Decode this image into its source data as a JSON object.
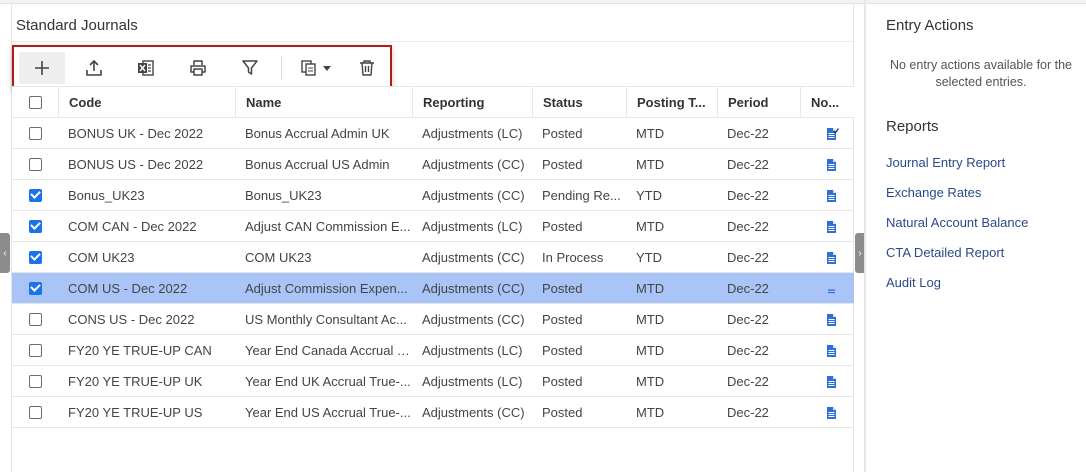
{
  "main": {
    "title": "Standard Journals",
    "toolbar": {
      "add_icon": "plus-icon",
      "upload_icon": "upload-icon",
      "excel_icon": "excel-export-icon",
      "print_icon": "print-icon",
      "filter_icon": "filter-icon",
      "copy_icon": "copy-dropdown-icon",
      "delete_icon": "trash-icon"
    },
    "columns": [
      "Code",
      "Name",
      "Reporting",
      "Status",
      "Posting T...",
      "Period",
      "No..."
    ],
    "rows": [
      {
        "checked": false,
        "selected": false,
        "code": "BONUS UK - Dec 2022",
        "name": "Bonus Accrual Admin UK",
        "reporting": "Adjustments (LC)",
        "status": "Posted",
        "posting": "MTD",
        "period": "Dec-22",
        "note_icon": "document-check-icon"
      },
      {
        "checked": false,
        "selected": false,
        "code": "BONUS US - Dec 2022",
        "name": "Bonus Accrual US Admin",
        "reporting": "Adjustments (CC)",
        "status": "Posted",
        "posting": "MTD",
        "period": "Dec-22",
        "note_icon": "document-icon"
      },
      {
        "checked": true,
        "selected": false,
        "code": "Bonus_UK23",
        "name": "Bonus_UK23",
        "reporting": "Adjustments (CC)",
        "status": "Pending Re...",
        "posting": "YTD",
        "period": "Dec-22",
        "note_icon": "document-icon"
      },
      {
        "checked": true,
        "selected": false,
        "code": "COM CAN - Dec 2022",
        "name": "Adjust CAN Commission E...",
        "reporting": "Adjustments (LC)",
        "status": "Posted",
        "posting": "MTD",
        "period": "Dec-22",
        "note_icon": "document-icon"
      },
      {
        "checked": true,
        "selected": false,
        "code": "COM UK23",
        "name": "COM UK23",
        "reporting": "Adjustments (CC)",
        "status": "In Process",
        "posting": "YTD",
        "period": "Dec-22",
        "note_icon": "document-icon"
      },
      {
        "checked": true,
        "selected": true,
        "code": "COM US - Dec 2022",
        "name": "Adjust Commission Expen...",
        "reporting": "Adjustments (CC)",
        "status": "Posted",
        "posting": "MTD",
        "period": "Dec-22",
        "note_icon": "lines-icon"
      },
      {
        "checked": false,
        "selected": false,
        "code": "CONS US - Dec 2022",
        "name": "US Monthly Consultant Ac...",
        "reporting": "Adjustments (CC)",
        "status": "Posted",
        "posting": "MTD",
        "period": "Dec-22",
        "note_icon": "document-icon"
      },
      {
        "checked": false,
        "selected": false,
        "code": "FY20 YE TRUE-UP CAN",
        "name": "Year End Canada Accrual T...",
        "reporting": "Adjustments (LC)",
        "status": "Posted",
        "posting": "MTD",
        "period": "Dec-22",
        "note_icon": "document-icon"
      },
      {
        "checked": false,
        "selected": false,
        "code": "FY20 YE TRUE-UP UK",
        "name": "Year End UK Accrual True-...",
        "reporting": "Adjustments (LC)",
        "status": "Posted",
        "posting": "MTD",
        "period": "Dec-22",
        "note_icon": "document-icon"
      },
      {
        "checked": false,
        "selected": false,
        "code": "FY20 YE TRUE-UP US",
        "name": "Year End US Accrual True-...",
        "reporting": "Adjustments (CC)",
        "status": "Posted",
        "posting": "MTD",
        "period": "Dec-22",
        "note_icon": "document-icon"
      }
    ]
  },
  "side": {
    "entry_actions_title": "Entry Actions",
    "entry_actions_msg": "No entry actions available for the selected entries.",
    "reports_title": "Reports",
    "links": [
      "Journal Entry Report",
      "Exchange Rates",
      "Natural Account Balance",
      "CTA Detailed Report",
      "Audit Log"
    ]
  },
  "colors": {
    "selected_row": "#a9c5f7",
    "checkbox_checked": "#1a73e8",
    "link": "#2a4a8a",
    "toolbar_highlight": "#b31b1b",
    "doc_icon": "#2f6fd6"
  }
}
